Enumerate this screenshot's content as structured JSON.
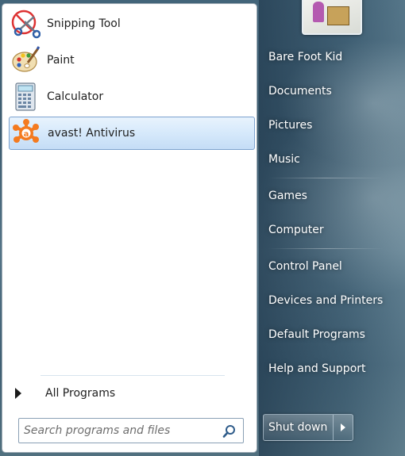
{
  "programs": [
    {
      "label": "Snipping Tool",
      "icon": "scissors-icon",
      "selected": false
    },
    {
      "label": "Paint",
      "icon": "palette-icon",
      "selected": false
    },
    {
      "label": "Calculator",
      "icon": "calculator-icon",
      "selected": false
    },
    {
      "label": "avast! Antivirus",
      "icon": "avast-icon",
      "selected": true
    }
  ],
  "all_programs": "All Programs",
  "search": {
    "placeholder": "Search programs and files"
  },
  "right_links": [
    "Bare Foot Kid",
    "Documents",
    "Pictures",
    "Music",
    "Games",
    "Computer",
    "Control Panel",
    "Devices and Printers",
    "Default Programs",
    "Help and Support"
  ],
  "shutdown": {
    "label": "Shut down"
  },
  "colors": {
    "selection_border": "#7da2ce",
    "selection_fill": "#d6e9fb",
    "glass": "#3d5c70"
  }
}
